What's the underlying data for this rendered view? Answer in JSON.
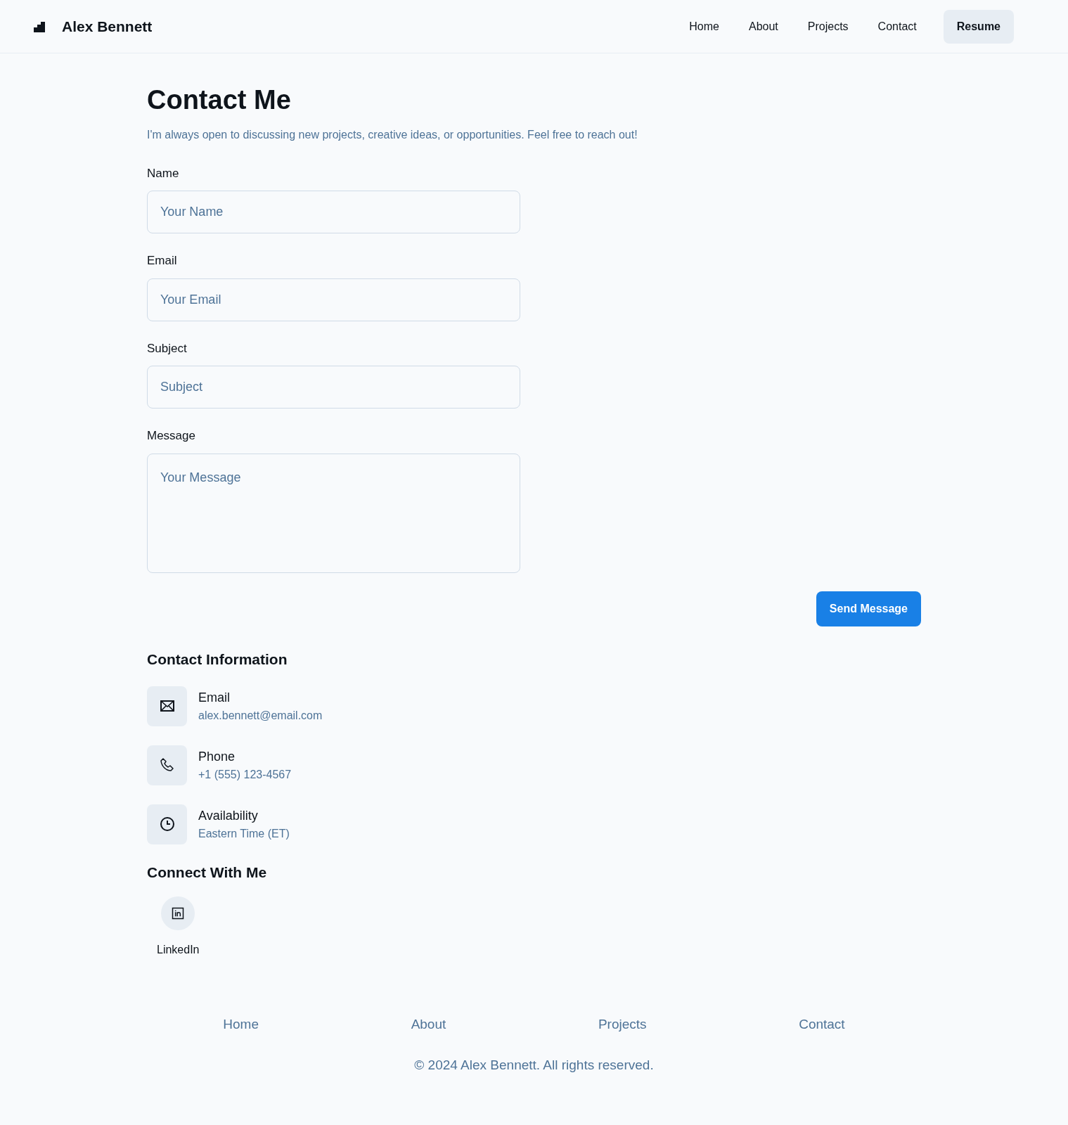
{
  "brand": {
    "name": "Alex Bennett"
  },
  "nav": [
    {
      "label": "Home",
      "selected": false
    },
    {
      "label": "About",
      "selected": false
    },
    {
      "label": "Projects",
      "selected": false
    },
    {
      "label": "Contact",
      "selected": false
    }
  ],
  "resume_button": "Resume",
  "title": "Contact Me",
  "intro": "I'm always open to discussing new projects, creative ideas, or opportunities. Feel free to reach out!",
  "form": {
    "fields": [
      {
        "label": "Name",
        "placeholder": "Your Name",
        "kind": "input"
      },
      {
        "label": "Email",
        "placeholder": "Your Email",
        "kind": "input"
      },
      {
        "label": "Subject",
        "placeholder": "Subject",
        "kind": "input"
      },
      {
        "label": "Message",
        "placeholder": "Your Message",
        "kind": "textarea"
      }
    ],
    "submit": "Send Message"
  },
  "contact_info": {
    "heading": "Contact Information",
    "items": [
      {
        "kind": "email",
        "label": "Email",
        "value": "alex.bennett@email.com"
      },
      {
        "kind": "phone",
        "label": "Phone",
        "value": "+1 (555) 123-4567"
      },
      {
        "kind": "clock",
        "label": "Availability",
        "value": "Eastern Time (ET)"
      }
    ]
  },
  "connect": {
    "heading": "Connect With Me",
    "links": [
      {
        "kind": "linkedin",
        "label": "LinkedIn"
      }
    ]
  },
  "footer": {
    "links": [
      "Home",
      "About",
      "Projects",
      "Contact"
    ],
    "copyright": "© 2024 Alex Bennett. All rights reserved."
  }
}
